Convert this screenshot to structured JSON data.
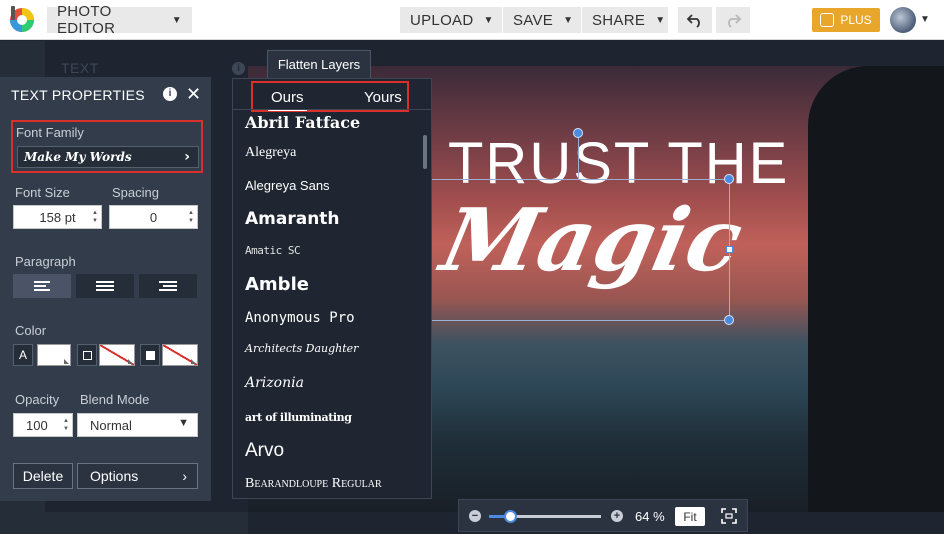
{
  "topbar": {
    "logo_icon": "color-wheel-logo-icon",
    "app_menu": "PHOTO EDITOR",
    "upload": "UPLOAD",
    "save": "SAVE",
    "share": "SHARE",
    "undo_icon": "undo-icon",
    "redo_icon": "redo-icon",
    "plus": "PLUS",
    "plus_color": "#e8a72a"
  },
  "side_tabs": {
    "text_tab": "TEXT",
    "flatten_layers": "Flatten Layers"
  },
  "text_properties": {
    "title": "TEXT PROPERTIES",
    "font_family_label": "Font Family",
    "font_family_value": "Make My Words",
    "font_size_label": "Font Size",
    "font_size_value": "158 pt",
    "spacing_label": "Spacing",
    "spacing_value": "0",
    "paragraph_label": "Paragraph",
    "paragraph_selected": "left",
    "color_label": "Color",
    "fill_letter": "A",
    "opacity_label": "Opacity",
    "opacity_value": "100",
    "blend_mode_label": "Blend Mode",
    "blend_mode_value": "Normal",
    "delete": "Delete",
    "options": "Options"
  },
  "font_dropdown": {
    "tabs": [
      "Ours",
      "Yours"
    ],
    "active_tab": "Ours",
    "fonts": [
      "Abril Fatface",
      "Alegreya",
      "Alegreya Sans",
      "Amaranth",
      "Amatic SC",
      "Amble",
      "Anonymous Pro",
      "Architects Daughter",
      "Arizonia",
      "art of illuminating",
      "Arvo",
      "Bearandloupe Regular"
    ]
  },
  "canvas": {
    "line1": "TRUST THE",
    "line2": "Magic"
  },
  "zoom": {
    "level": "64 %",
    "level_fraction": 0.2,
    "fit": "Fit"
  },
  "colors": {
    "accent": "#4a8be0",
    "highlight": "#d9302b",
    "panel": "#323c4b"
  }
}
